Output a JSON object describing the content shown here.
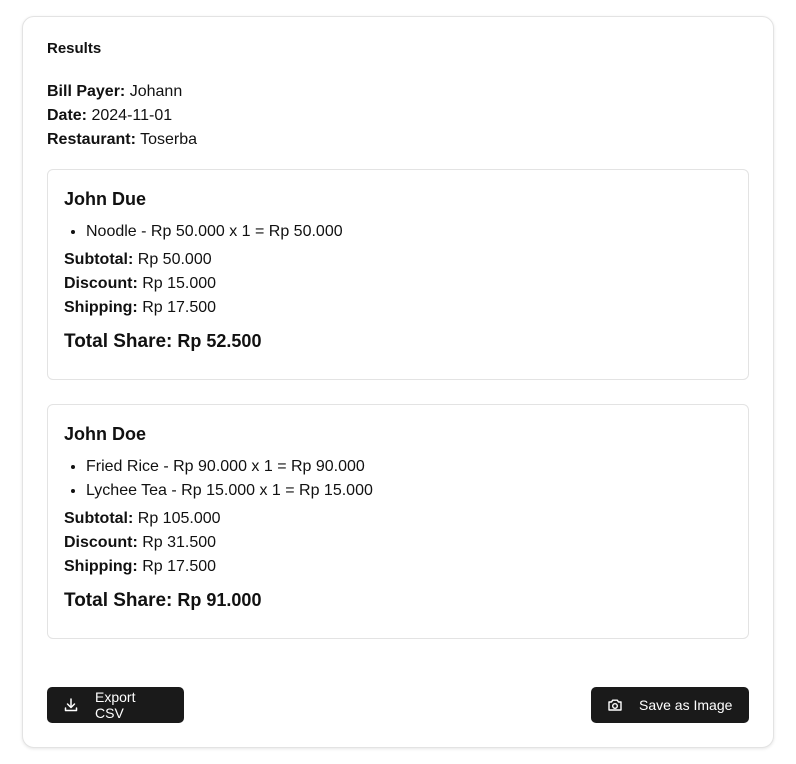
{
  "results": {
    "title": "Results",
    "meta": {
      "bill_payer_label": "Bill Payer:",
      "bill_payer": "Johann",
      "date_label": "Date:",
      "date": "2024-11-01",
      "restaurant_label": "Restaurant:",
      "restaurant": "Toserba"
    },
    "people": [
      {
        "name": "John Due",
        "items": [
          "Noodle - Rp 50.000 x 1 = Rp 50.000"
        ],
        "subtotal_label": "Subtotal:",
        "subtotal": "Rp 50.000",
        "discount_label": "Discount:",
        "discount": "Rp 15.000",
        "shipping_label": "Shipping:",
        "shipping": "Rp 17.500",
        "total_label": "Total Share:",
        "total": "Rp 52.500"
      },
      {
        "name": "John Doe",
        "items": [
          "Fried Rice - Rp 90.000 x 1 = Rp 90.000",
          "Lychee Tea - Rp 15.000 x 1 = Rp 15.000"
        ],
        "subtotal_label": "Subtotal:",
        "subtotal": "Rp 105.000",
        "discount_label": "Discount:",
        "discount": "Rp 31.500",
        "shipping_label": "Shipping:",
        "shipping": "Rp 17.500",
        "total_label": "Total Share:",
        "total": "Rp 91.000"
      }
    ],
    "actions": {
      "export_label": "Export CSV",
      "export_icon": "download-icon",
      "save_label": "Save as Image",
      "save_icon": "camera-icon"
    }
  }
}
